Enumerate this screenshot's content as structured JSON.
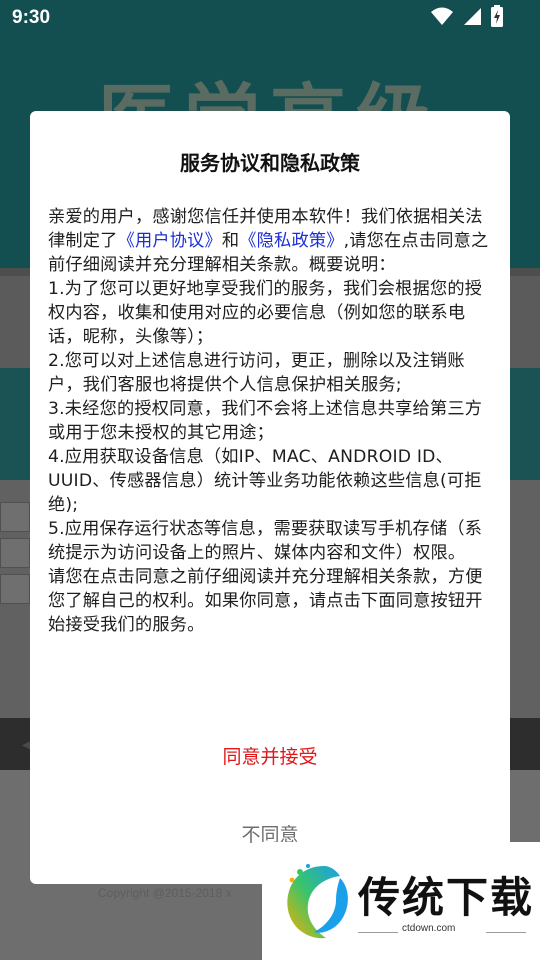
{
  "status_bar": {
    "time": "9:30"
  },
  "background_app": {
    "title": "医学高级",
    "copyright": "Copyright @2015-2018 x"
  },
  "dialog": {
    "title": "服务协议和隐私政策",
    "body": {
      "p1_prefix": "亲爱的用户，感谢您信任并使用本软件！我们依据相关法律制定了",
      "link_user_agreement": "《用户协议》",
      "p1_and": "和",
      "link_privacy_policy": "《隐私政策》",
      "p1_suffix": ",请您在点击同意之前仔细阅读并充分理解相关条款。概要说明：",
      "item1": "1.为了您可以更好地享受我们的服务，我们会根据您的授权内容，收集和使用对应的必要信息（例如您的联系电话，昵称，头像等）；",
      "item2": "2.您可以对上述信息进行访问，更正，删除以及注销账户，我们客服也将提供个人信息保护相关服务;",
      "item3": "3.未经您的授权同意，我们不会将上述信息共享给第三方或用于您未授权的其它用途；",
      "item4": "4.应用获取设备信息（如IP、MAC、ANDROID ID、UUID、传感器信息）统计等业务功能依赖这些信息(可拒绝);",
      "item5": "5.应用保存运行状态等信息，需要获取读写手机存储（系统提示为访问设备上的照片、媒体内容和文件）权限。",
      "closing": "请您在点击同意之前仔细阅读并充分理解相关条款，方便您了解自己的权利。如果你同意，请点击下面同意按钮开始接受我们的服务。"
    },
    "agree_label": "同意并接受",
    "disagree_label": "不同意"
  },
  "watermark": {
    "text": "传统下载",
    "url": "ctdown.com"
  },
  "colors": {
    "link": "#1a2fd6",
    "agree": "#e0181a",
    "disagree": "#6e6e6e",
    "background_header": "#134e50"
  }
}
